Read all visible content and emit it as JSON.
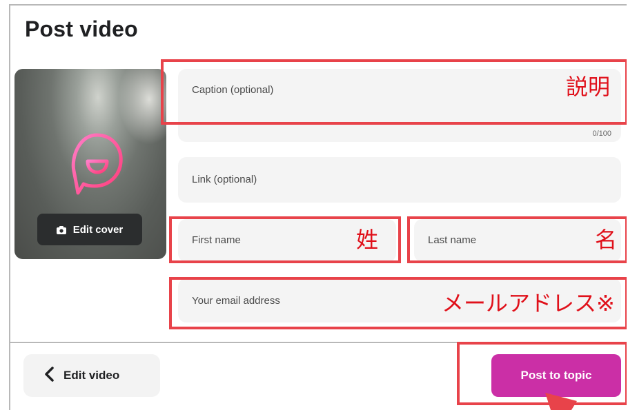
{
  "header": {
    "title": "Post video"
  },
  "thumbnail": {
    "edit_cover_label": "Edit cover"
  },
  "form": {
    "caption": {
      "placeholder": "Caption (optional)",
      "counter": "0/100"
    },
    "link": {
      "placeholder": "Link (optional)"
    },
    "first_name": {
      "placeholder": "First name"
    },
    "last_name": {
      "placeholder": "Last name"
    },
    "email": {
      "placeholder": "Your email address"
    }
  },
  "annotations": {
    "caption": "説明",
    "first_name": "姓",
    "last_name": "名",
    "email": "メールアドレス※"
  },
  "footer": {
    "back_label": "Edit video",
    "post_label": "Post to topic"
  },
  "colors": {
    "accent": "#cb2fa6",
    "annotation": "#e8434a",
    "field_bg": "#f4f4f4"
  }
}
